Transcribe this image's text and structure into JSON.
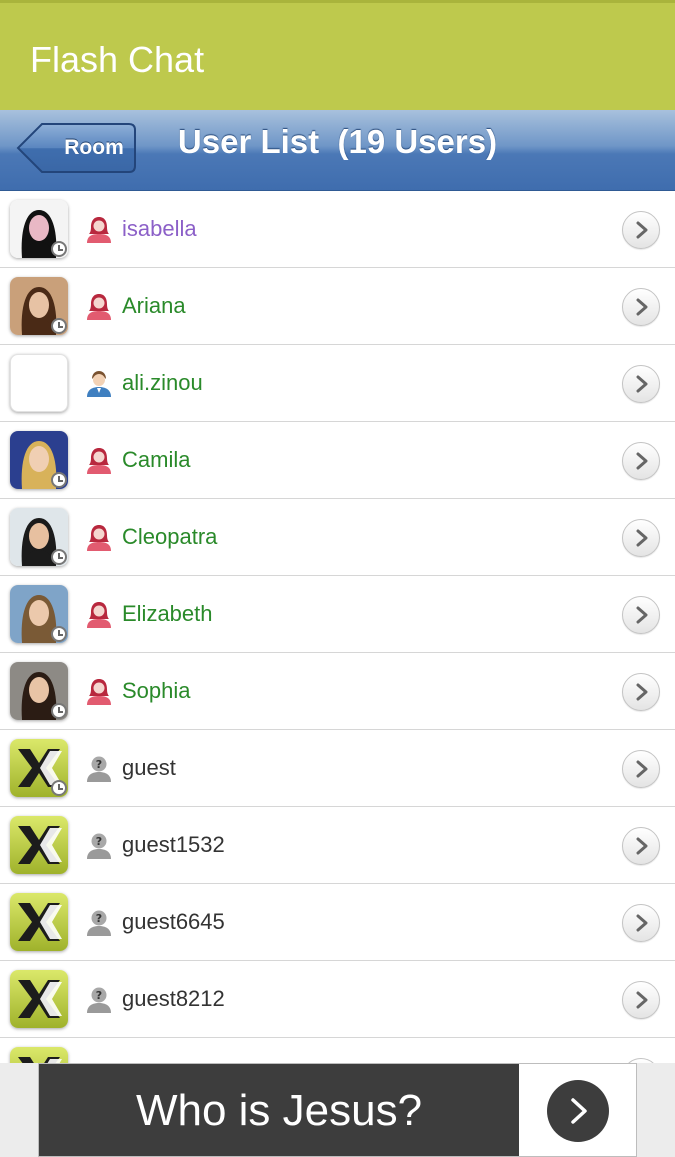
{
  "app": {
    "title": "Flash Chat"
  },
  "nav": {
    "back_label": "Room",
    "title": "User List  (19 Users)"
  },
  "users": [
    {
      "name": "isabella",
      "gender": "female",
      "name_color": "#8c60c8",
      "avatar": "photo",
      "status": "clock"
    },
    {
      "name": "Ariana",
      "gender": "female",
      "name_color": "#2a8a2a",
      "avatar": "photo",
      "status": "clock"
    },
    {
      "name": "ali.zinou",
      "gender": "male",
      "name_color": "#2a8a2a",
      "avatar": "blank",
      "status": "none"
    },
    {
      "name": "Camila",
      "gender": "female",
      "name_color": "#2a8a2a",
      "avatar": "photo",
      "status": "clock"
    },
    {
      "name": "Cleopatra",
      "gender": "female",
      "name_color": "#2a8a2a",
      "avatar": "photo",
      "status": "clock"
    },
    {
      "name": "Elizabeth",
      "gender": "female",
      "name_color": "#2a8a2a",
      "avatar": "photo",
      "status": "clock"
    },
    {
      "name": "Sophia",
      "gender": "female",
      "name_color": "#2a8a2a",
      "avatar": "photo",
      "status": "clock"
    },
    {
      "name": "guest",
      "gender": "guest",
      "name_color": "#333333",
      "avatar": "app-logo",
      "status": "clock"
    },
    {
      "name": "guest1532",
      "gender": "guest",
      "name_color": "#333333",
      "avatar": "app-logo",
      "status": "none"
    },
    {
      "name": "guest6645",
      "gender": "guest",
      "name_color": "#333333",
      "avatar": "app-logo",
      "status": "none"
    },
    {
      "name": "guest8212",
      "gender": "guest",
      "name_color": "#333333",
      "avatar": "app-logo",
      "status": "none"
    },
    {
      "name": "",
      "gender": "guest",
      "name_color": "#333333",
      "avatar": "app-logo",
      "status": "none"
    }
  ],
  "ad": {
    "text": "Who is Jesus?"
  },
  "colors": {
    "appbar": "#bec94d",
    "navbar": "#4b78b6",
    "female_icon": "#d9435a",
    "male_icon": "#3f7fc0",
    "guest_icon": "#9a9a9a"
  }
}
